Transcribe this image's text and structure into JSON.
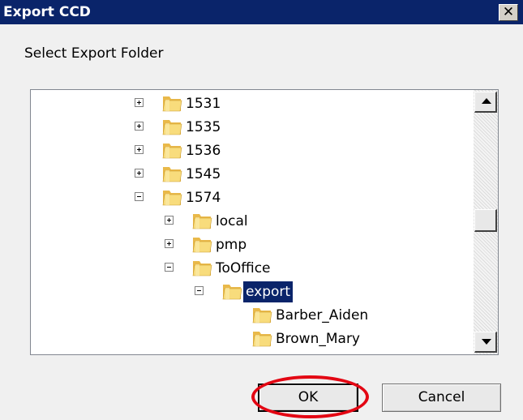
{
  "dialog": {
    "title": "Export CCD",
    "close_glyph": "✕",
    "prompt": "Select Export Folder"
  },
  "tree": {
    "items": [
      {
        "label": "1531",
        "level": 0,
        "expander": "plus",
        "icon": "folder-icon"
      },
      {
        "label": "1535",
        "level": 0,
        "expander": "plus",
        "icon": "folder-icon"
      },
      {
        "label": "1536",
        "level": 0,
        "expander": "plus",
        "icon": "folder-icon"
      },
      {
        "label": "1545",
        "level": 0,
        "expander": "plus",
        "icon": "folder-icon"
      },
      {
        "label": "1574",
        "level": 0,
        "expander": "minus",
        "icon": "folder-icon"
      },
      {
        "label": "local",
        "level": 1,
        "expander": "plus",
        "icon": "folder-icon"
      },
      {
        "label": "pmp",
        "level": 1,
        "expander": "plus",
        "icon": "folder-icon"
      },
      {
        "label": "ToOffice",
        "level": 1,
        "expander": "minus",
        "icon": "folder-icon"
      },
      {
        "label": "export",
        "level": 2,
        "expander": "minus",
        "icon": "folder-icon",
        "selected": true
      },
      {
        "label": "Barber_Aiden",
        "level": 3,
        "expander": "none",
        "icon": "folder-icon"
      },
      {
        "label": "Brown_Mary",
        "level": 3,
        "expander": "none",
        "icon": "folder-icon"
      }
    ]
  },
  "buttons": {
    "ok": "OK",
    "cancel": "Cancel"
  },
  "colors": {
    "title_bar": "#0a246a",
    "selection": "#0a246a",
    "highlight_ring": "#e30613",
    "folder": "#f3d36b"
  }
}
